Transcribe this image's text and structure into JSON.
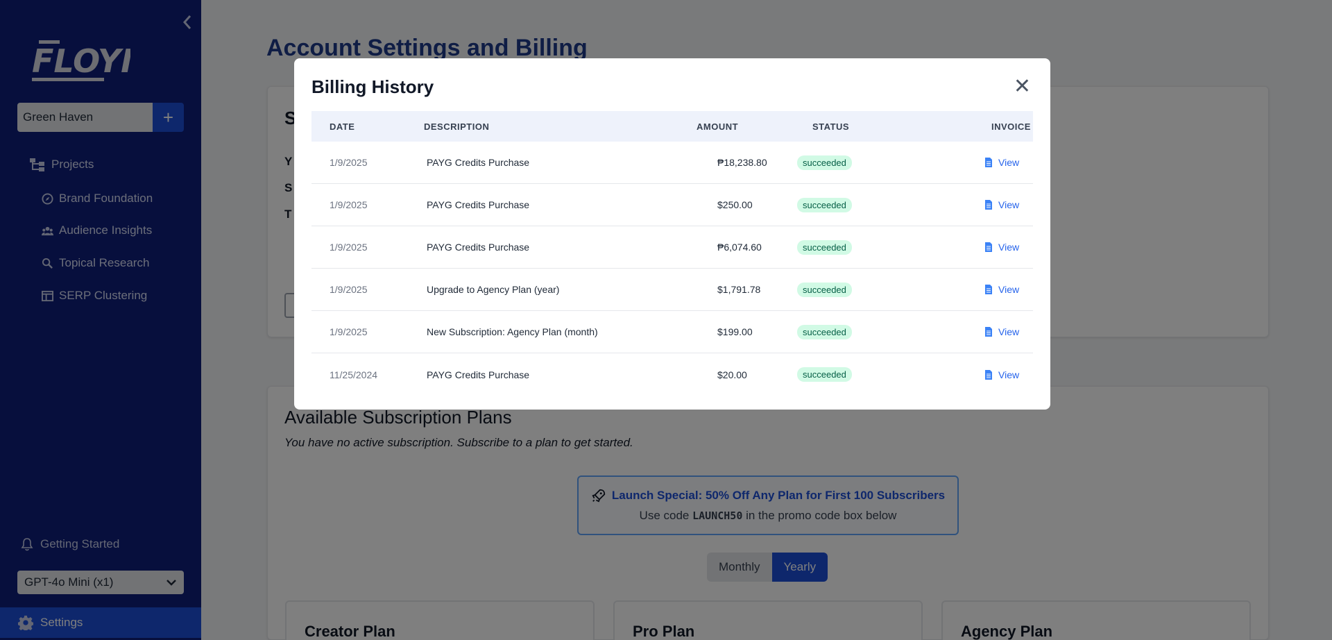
{
  "sidebar": {
    "project_name": "Green Haven",
    "nav": [
      {
        "label": "Projects"
      },
      {
        "label": "Brand Foundation"
      },
      {
        "label": "Audience Insights"
      },
      {
        "label": "Topical Research"
      },
      {
        "label": "SERP Clustering"
      }
    ],
    "getting_started": "Getting Started",
    "model_select": "GPT-4o Mini (x1)",
    "settings": "Settings"
  },
  "main": {
    "page_title": "Account Settings and Billing",
    "plans_title": "Available Subscription Plans",
    "plans_subtitle": "You have no active subscription. Subscribe to a plan to get started.",
    "promo": {
      "title": "Launch Special: 50% Off Any Plan for First 100 Subscribers",
      "sub_prefix": "Use code",
      "code": "LAUNCH50",
      "sub_suffix": "in the promo code box below"
    },
    "billing_toggle": {
      "monthly": "Monthly",
      "yearly": "Yearly",
      "selected": "Yearly"
    },
    "plans": [
      "Creator Plan",
      "Pro Plan",
      "Agency Plan"
    ]
  },
  "modal": {
    "title": "Billing History",
    "close": "✕",
    "columns": {
      "date": "DATE",
      "description": "DESCRIPTION",
      "amount": "AMOUNT",
      "status": "STATUS",
      "invoice": "INVOICE"
    },
    "rows": [
      {
        "date": "1/9/2025",
        "description": "PAYG Credits Purchase",
        "amount": "₱18,238.80",
        "status": "succeeded",
        "invoice": "View"
      },
      {
        "date": "1/9/2025",
        "description": "PAYG Credits Purchase",
        "amount": "$250.00",
        "status": "succeeded",
        "invoice": "View"
      },
      {
        "date": "1/9/2025",
        "description": "PAYG Credits Purchase",
        "amount": "₱6,074.60",
        "status": "succeeded",
        "invoice": "View"
      },
      {
        "date": "1/9/2025",
        "description": "Upgrade to Agency Plan (year)",
        "amount": "$1,791.78",
        "status": "succeeded",
        "invoice": "View"
      },
      {
        "date": "1/9/2025",
        "description": "New Subscription: Agency Plan (month)",
        "amount": "$199.00",
        "status": "succeeded",
        "invoice": "View"
      },
      {
        "date": "11/25/2024",
        "description": "PAYG Credits Purchase",
        "amount": "$20.00",
        "status": "succeeded",
        "invoice": "View"
      }
    ]
  },
  "colors": {
    "sidebar_bg": "#0f1f7a",
    "accent": "#1d4ed8",
    "title": "#1e3a8a",
    "success_bg": "#d1fae5",
    "success_text": "#065f46"
  }
}
